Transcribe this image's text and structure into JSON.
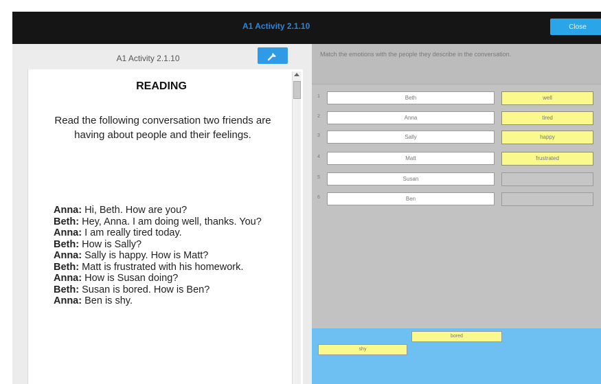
{
  "window": {
    "title": "A1 Activity 2.1.10",
    "close_label": "Close"
  },
  "left": {
    "header_title": "A1 Activity 2.1.10",
    "tool_icon": "wrench-icon",
    "heading": "READING",
    "intro": "Read the following conversation two friends are having about people and their feelings.",
    "dialogue": [
      {
        "speaker": "Anna:",
        "text": " Hi, Beth.  How are you?"
      },
      {
        "speaker": "Beth:",
        "text": " Hey, Anna.  I am doing well, thanks.  You?"
      },
      {
        "speaker": "Anna:",
        "text": " I am really tired today."
      },
      {
        "speaker": "Beth:",
        "text": " How is Sally?"
      },
      {
        "speaker": "Anna:",
        "text": " Sally is happy.  How is Matt?"
      },
      {
        "speaker": "Beth:",
        "text": " Matt is frustrated with his homework."
      },
      {
        "speaker": "Anna:",
        "text": " How is Susan doing?"
      },
      {
        "speaker": "Beth:",
        "text": " Susan is bored.  How is Ben?"
      },
      {
        "speaker": "Anna:",
        "text": " Ben is shy."
      }
    ]
  },
  "right": {
    "instruction": "Match the emotions with the people they describe in the conversation.",
    "rows": [
      {
        "num": "1",
        "name": "Beth",
        "answer": "well"
      },
      {
        "num": "2",
        "name": "Anna",
        "answer": "tired"
      },
      {
        "num": "3",
        "name": "Sally",
        "answer": "happy"
      },
      {
        "num": "4",
        "name": "Matt",
        "answer": "frustrated"
      },
      {
        "num": "5",
        "name": "Susan",
        "answer": ""
      },
      {
        "num": "6",
        "name": "Ben",
        "answer": ""
      }
    ],
    "bank": [
      "bored",
      "shy"
    ]
  },
  "colors": {
    "topbar": "#151515",
    "accent": "#2aa6e8",
    "chip": "#faf98e",
    "bank": "#6ec0f2"
  }
}
